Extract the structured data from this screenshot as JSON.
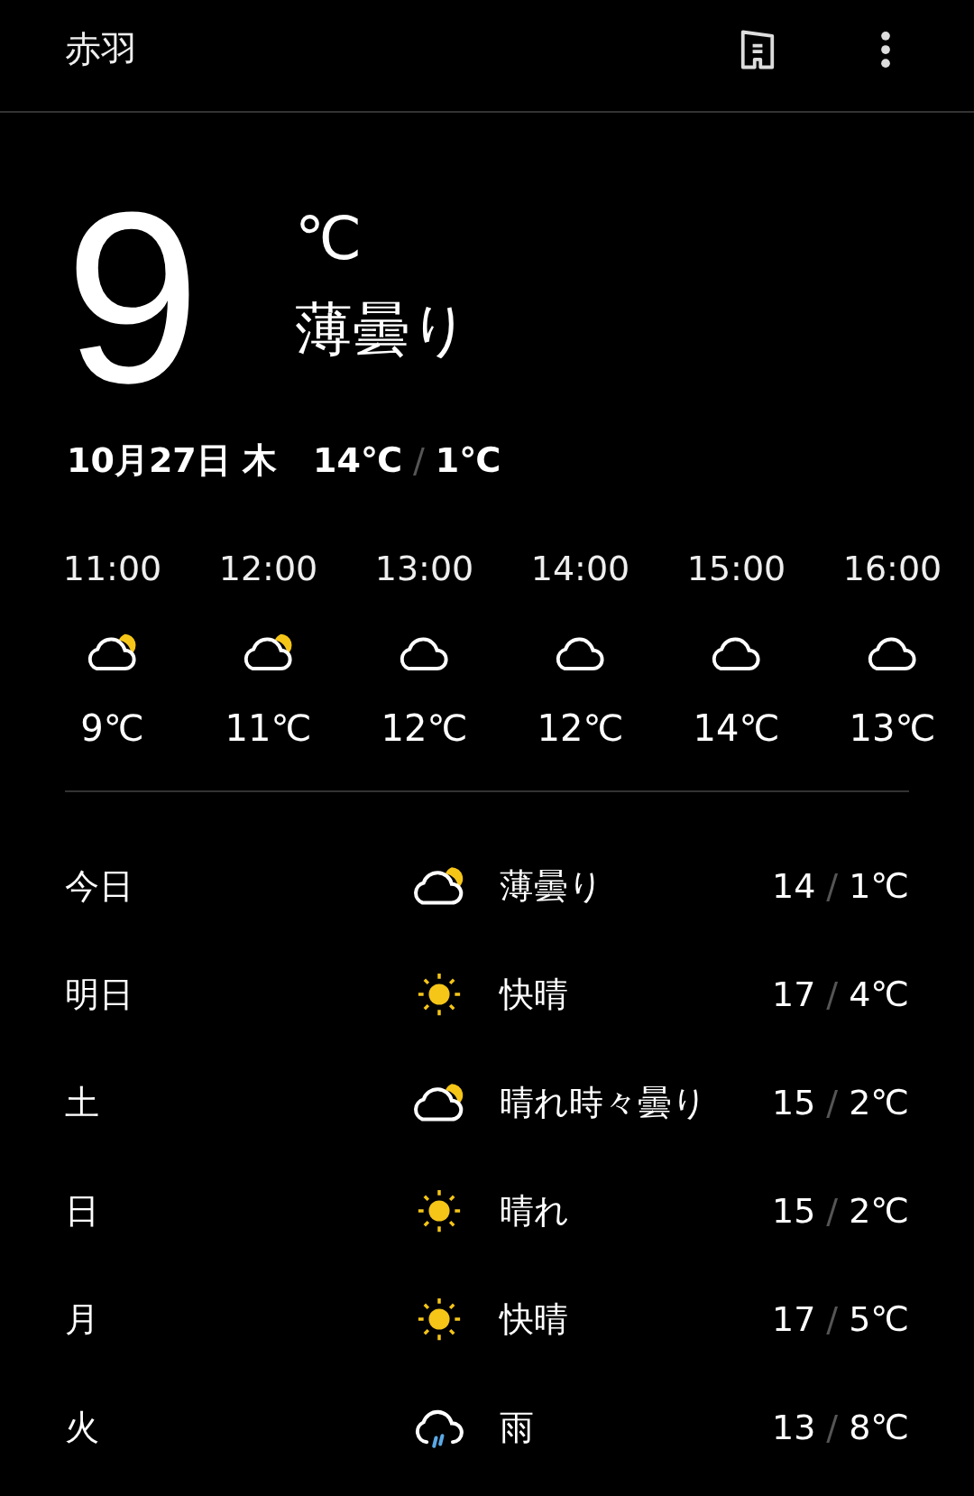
{
  "header": {
    "title": "赤羽"
  },
  "current": {
    "temperature": "9",
    "unit": "℃",
    "condition": "薄曇り"
  },
  "date_line": {
    "date": "10月27日 木",
    "high": "14℃",
    "separator": "/",
    "low": "1℃"
  },
  "hourly": [
    {
      "time": "11:00",
      "kind": "partly-cloudy",
      "temp": "9℃"
    },
    {
      "time": "12:00",
      "kind": "partly-cloudy",
      "temp": "11℃"
    },
    {
      "time": "13:00",
      "kind": "cloudy",
      "temp": "12℃"
    },
    {
      "time": "14:00",
      "kind": "cloudy",
      "temp": "12℃"
    },
    {
      "time": "15:00",
      "kind": "cloudy",
      "temp": "14℃"
    },
    {
      "time": "16:00",
      "kind": "cloudy",
      "temp": "13℃"
    }
  ],
  "daily": [
    {
      "day": "今日",
      "kind": "partly-cloudy",
      "condition": "薄曇り",
      "high": "14",
      "separator": "/",
      "low": "1℃"
    },
    {
      "day": "明日",
      "kind": "sunny",
      "condition": "快晴",
      "high": "17",
      "separator": "/",
      "low": "4℃"
    },
    {
      "day": "土",
      "kind": "partly-cloudy",
      "condition": "晴れ時々曇り",
      "high": "15",
      "separator": "/",
      "low": "2℃"
    },
    {
      "day": "日",
      "kind": "sunny",
      "condition": "晴れ",
      "high": "15",
      "separator": "/",
      "low": "2℃"
    },
    {
      "day": "月",
      "kind": "sunny",
      "condition": "快晴",
      "high": "17",
      "separator": "/",
      "low": "5℃"
    },
    {
      "day": "火",
      "kind": "rain",
      "condition": "雨",
      "high": "13",
      "separator": "/",
      "low": "8℃"
    }
  ]
}
